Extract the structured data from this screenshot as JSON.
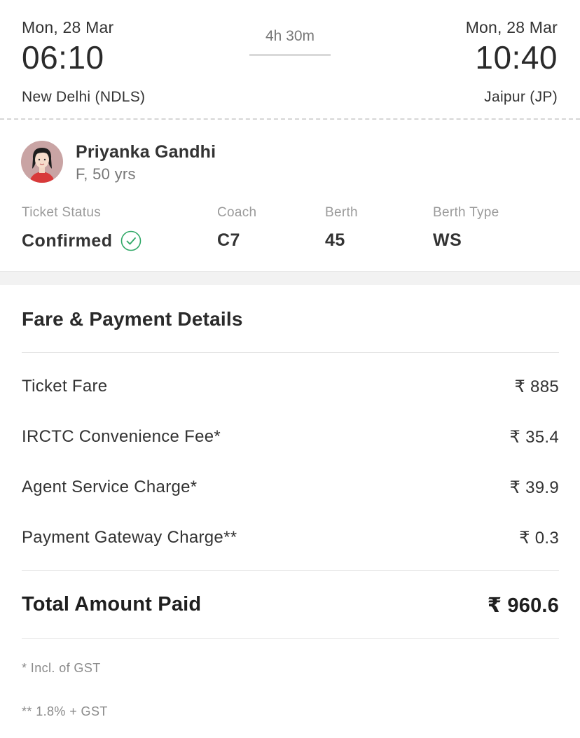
{
  "journey": {
    "departure": {
      "date": "Mon, 28 Mar",
      "time": "06:10",
      "station": "New Delhi (NDLS)"
    },
    "duration": "4h 30m",
    "arrival": {
      "date": "Mon, 28 Mar",
      "time": "10:40",
      "station": "Jaipur (JP)"
    }
  },
  "passenger": {
    "name": "Priyanka Gandhi",
    "meta": "F, 50 yrs",
    "columns": [
      {
        "label": "Ticket Status",
        "value": "Confirmed"
      },
      {
        "label": "Coach",
        "value": "C7"
      },
      {
        "label": "Berth",
        "value": "45"
      },
      {
        "label": "Berth Type",
        "value": "WS"
      }
    ]
  },
  "fare": {
    "title": "Fare & Payment Details",
    "rows": [
      {
        "label": "Ticket Fare",
        "amount": "₹ 885"
      },
      {
        "label": "IRCTC Convenience Fee*",
        "amount": "₹ 35.4"
      },
      {
        "label": "Agent Service Charge*",
        "amount": "₹ 39.9"
      },
      {
        "label": "Payment Gateway Charge**",
        "amount": "₹ 0.3"
      }
    ],
    "total": {
      "label": "Total Amount Paid",
      "amount": "₹ 960.6"
    },
    "notes": [
      "* Incl. of GST",
      "** 1.8% + GST"
    ]
  },
  "colors": {
    "confirmed_check": "#2fa866",
    "avatar_bg": "#c9a4a4",
    "avatar_shirt": "#d83a3a"
  },
  "icons": {
    "status": "check-circle-icon",
    "avatar": "woman-avatar-icon"
  }
}
